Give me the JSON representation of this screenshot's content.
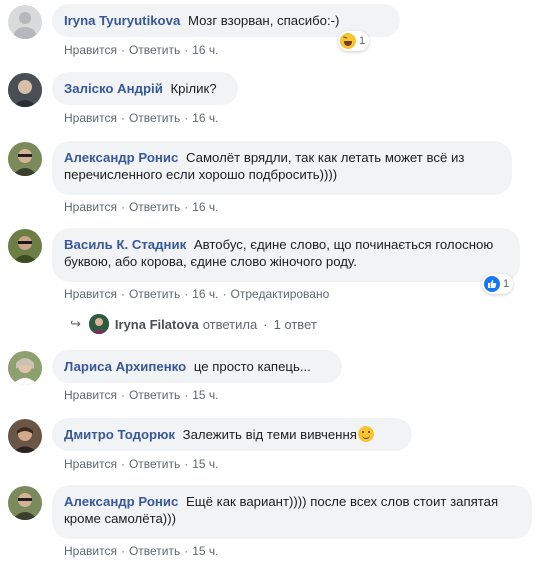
{
  "actions": {
    "like": "Нравится",
    "reply": "Ответить",
    "separator": "·"
  },
  "comments": [
    {
      "author": "Iryna Tyuryutikova",
      "text": "Мозг взорван, спасибо:-)",
      "time": "16 ч.",
      "reaction": {
        "icon": "haha-icon",
        "count": "1"
      },
      "avatar_color": "#d9dadc"
    },
    {
      "author": "Заліско Андрій",
      "text": "Крілик?",
      "time": "16 ч.",
      "avatar_color": "#5a5f66"
    },
    {
      "author": "Александр Ронис",
      "text": "Самолёт врядли, так как летать может всё из перечисленного если хорошо подбросить))))",
      "time": "16 ч.",
      "avatar_color": "#6b7a4a"
    },
    {
      "author": "Василь К. Стадник",
      "text": "Автобус, єдине слово, що починається голосною буквою, або корова, єдине слово жіночого роду.",
      "time": "16 ч.",
      "edited": "Отредактировано",
      "reaction": {
        "icon": "like-icon",
        "count": "1"
      },
      "avatar_color": "#5b6e3c"
    },
    {
      "author": "Лариса Архипенко",
      "text": "це просто капець...",
      "time": "15 ч.",
      "avatar_color": "#8a9a6a"
    },
    {
      "author": "Дмитро Тодорюк",
      "text": "Залежить від теми вивчення",
      "time": "15 ч.",
      "avatar_color": "#6a5646"
    },
    {
      "author": "Александр Ронис",
      "text": "Ещё как вариант)))) после всех слов стоит запятая кроме самолёта)))",
      "time": "15 ч.",
      "avatar_color": "#6b7a4a"
    }
  ],
  "reply_thread": {
    "name": "Iryna Filatova",
    "verb": "ответила",
    "count": "1 ответ"
  },
  "colors": {
    "author": "#385898",
    "bubble": "#f2f3f5",
    "meta": "#606770",
    "like_blue": "#1877f2",
    "haha_yellow": "#f7c531"
  }
}
